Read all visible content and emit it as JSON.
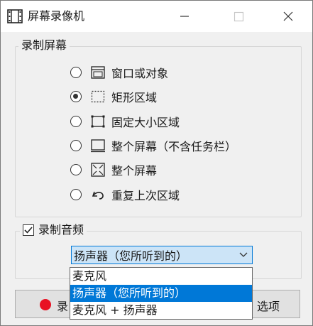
{
  "window": {
    "title": "屏幕录像机",
    "controls": [
      "minimize",
      "maximize",
      "close"
    ]
  },
  "record_screen": {
    "group_label": "录制屏幕",
    "modes": [
      {
        "label": "窗口或对象",
        "icon": "window-icon",
        "selected": false
      },
      {
        "label": "矩形区域",
        "icon": "dashed-rectangle-icon",
        "selected": true
      },
      {
        "label": "固定大小区域",
        "icon": "fixed-size-region-icon",
        "selected": false
      },
      {
        "label": "整个屏幕（不含任务栏）",
        "icon": "screen-without-taskbar-icon",
        "selected": false
      },
      {
        "label": "整个屏幕",
        "icon": "full-screen-icon",
        "selected": false
      },
      {
        "label": "重复上次区域",
        "icon": "repeat-arrow-icon",
        "selected": false
      }
    ]
  },
  "record_audio": {
    "label": "录制音频",
    "checked": true,
    "selected_source": "扬声器（您所听到的）",
    "options": [
      "麦克风",
      "扬声器（您所听到的）",
      "麦克风 + 扬声器"
    ],
    "highlighted_index": 1
  },
  "buttons": {
    "record_label": "录",
    "options_label": "选项"
  },
  "colors": {
    "accent": "#0078d7",
    "combo_bg": "#cce4f7",
    "record_dot": "#e81123"
  }
}
